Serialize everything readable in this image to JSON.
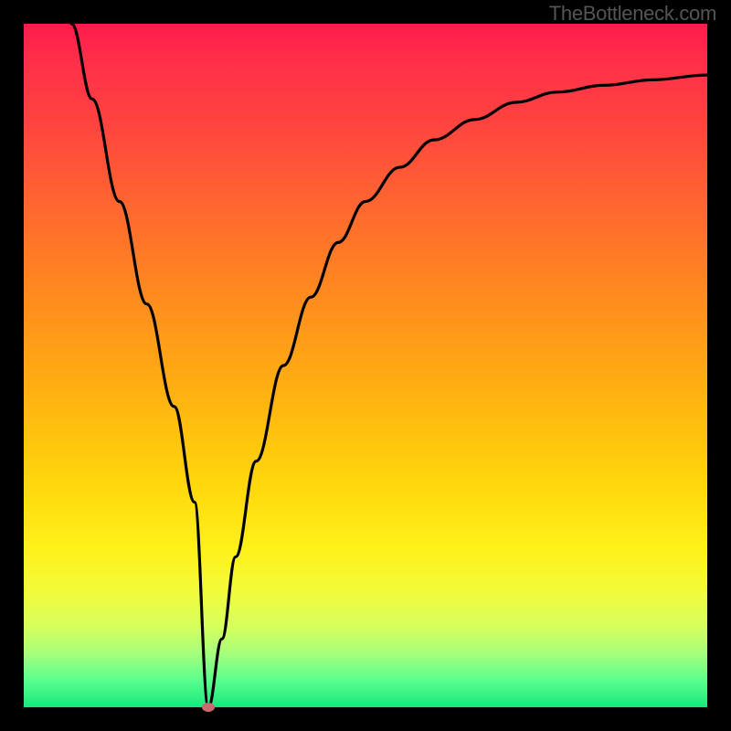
{
  "watermark": "TheBottleneck.com",
  "chart_data": {
    "type": "line",
    "title": "",
    "xlabel": "",
    "ylabel": "",
    "xlim": [
      0,
      100
    ],
    "ylim": [
      0,
      100
    ],
    "grid": false,
    "legend": false,
    "marker": {
      "x": 27,
      "y": 0,
      "color": "#c96a6e"
    },
    "series": [
      {
        "name": "bottleneck-curve",
        "color": "#000000",
        "x": [
          7,
          10,
          14,
          18,
          22,
          25,
          27,
          29,
          31,
          34,
          38,
          42,
          46,
          50,
          55,
          60,
          66,
          72,
          78,
          85,
          92,
          100
        ],
        "y": [
          100,
          89,
          74,
          59,
          44,
          30,
          0,
          10,
          22,
          36,
          50,
          60,
          68,
          74,
          79,
          83,
          86,
          88.5,
          90,
          91,
          91.8,
          92.5
        ]
      }
    ],
    "background_gradient": {
      "type": "vertical",
      "stops": [
        {
          "pos": 0,
          "color": "#ff1a4d"
        },
        {
          "pos": 14,
          "color": "#ff4240"
        },
        {
          "pos": 40,
          "color": "#ff8b1e"
        },
        {
          "pos": 67,
          "color": "#ffd60c"
        },
        {
          "pos": 83,
          "color": "#f2fb3a"
        },
        {
          "pos": 96,
          "color": "#5bff8e"
        },
        {
          "pos": 100,
          "color": "#17e87c"
        }
      ]
    }
  }
}
